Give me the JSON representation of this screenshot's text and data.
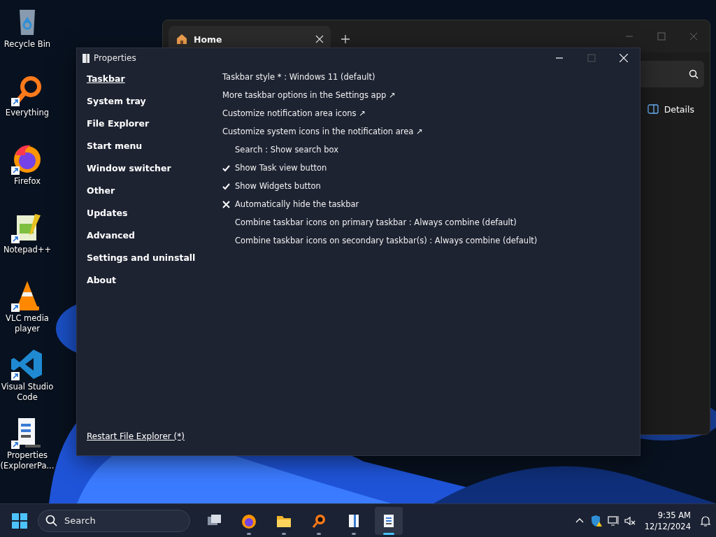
{
  "desktop_icons": [
    {
      "label": "Recycle Bin",
      "kind": "recycle",
      "shortcut": false
    },
    {
      "label": "Everything",
      "kind": "everything",
      "shortcut": true
    },
    {
      "label": "Firefox",
      "kind": "firefox",
      "shortcut": true
    },
    {
      "label": "Notepad++",
      "kind": "notepad",
      "shortcut": true
    },
    {
      "label": "VLC media player",
      "kind": "vlc",
      "shortcut": true
    },
    {
      "label": "Visual Studio Code",
      "kind": "vscode",
      "shortcut": true
    },
    {
      "label": "Properties (ExplorerPa...",
      "kind": "properties",
      "shortcut": true
    }
  ],
  "explorer_window": {
    "tab": {
      "label": "Home"
    },
    "details_button": "Details"
  },
  "properties_window": {
    "title": "Properties",
    "sidebar": [
      {
        "label": "Taskbar",
        "selected": true
      },
      {
        "label": "System tray",
        "selected": false
      },
      {
        "label": "File Explorer",
        "selected": false
      },
      {
        "label": "Start menu",
        "selected": false
      },
      {
        "label": "Window switcher",
        "selected": false
      },
      {
        "label": "Other",
        "selected": false
      },
      {
        "label": "Updates",
        "selected": false
      },
      {
        "label": "Advanced",
        "selected": false
      },
      {
        "label": "Settings and uninstall",
        "selected": false
      },
      {
        "label": "About",
        "selected": false
      }
    ],
    "footer_link": "Restart File Explorer (*)",
    "settings": [
      {
        "kind": "dropdown",
        "label": "Taskbar style * : Windows 11 (default)"
      },
      {
        "kind": "link",
        "label": "More taskbar options in the Settings app ↗"
      },
      {
        "kind": "link",
        "label": "Customize notification area icons ↗"
      },
      {
        "kind": "link",
        "label": "Customize system icons in the notification area ↗"
      },
      {
        "kind": "choice",
        "label": "Search : Show search box"
      },
      {
        "kind": "toggle",
        "label": "Show Task view button",
        "checked": true
      },
      {
        "kind": "toggle",
        "label": "Show Widgets button",
        "checked": true
      },
      {
        "kind": "toggle",
        "label": "Automatically hide the taskbar",
        "checked": false
      },
      {
        "kind": "choice",
        "label": "Combine taskbar icons on primary taskbar : Always combine (default)"
      },
      {
        "kind": "choice",
        "label": "Combine taskbar icons on secondary taskbar(s) : Always combine (default)"
      }
    ]
  },
  "taskbar": {
    "search": {
      "placeholder": "Search"
    },
    "apps": [
      {
        "kind": "taskview",
        "running": false,
        "selected": false
      },
      {
        "kind": "firefox",
        "running": true,
        "selected": false
      },
      {
        "kind": "folder",
        "running": true,
        "selected": false
      },
      {
        "kind": "everything",
        "running": true,
        "selected": false
      },
      {
        "kind": "properties",
        "running": true,
        "selected": false
      },
      {
        "kind": "settings",
        "running": true,
        "selected": true
      }
    ],
    "time": "9:35 AM",
    "date": "12/12/2024"
  }
}
